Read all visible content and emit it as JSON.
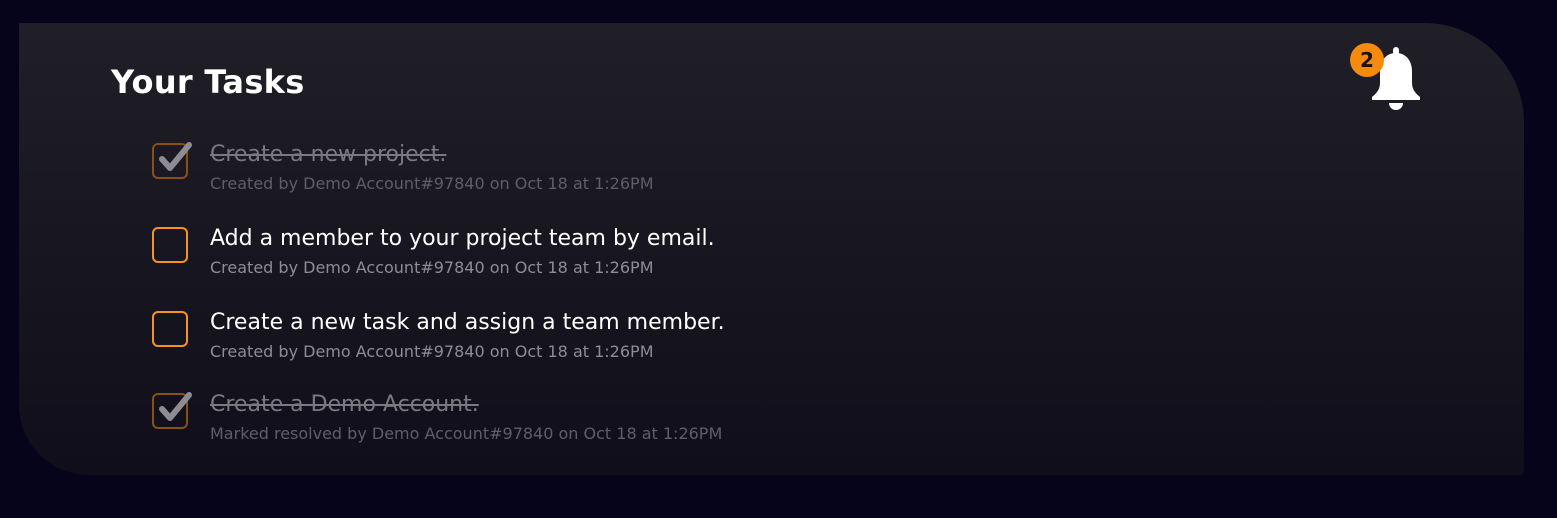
{
  "panel": {
    "title": "Your Tasks"
  },
  "notifications": {
    "icon": "bell-icon",
    "badge_count": "2",
    "badge_color": "#f58a0c"
  },
  "colors": {
    "background": "#05041a",
    "accent": "#f5931e",
    "text_primary": "#ffffff",
    "text_muted": "#8e8d96"
  },
  "tasks": [
    {
      "title": "Create a new project.",
      "meta": "Created by Demo Account#97840 on Oct 18 at 1:26PM",
      "completed": true
    },
    {
      "title": "Add a member to your project team by email.",
      "meta": "Created by Demo Account#97840 on Oct 18 at 1:26PM",
      "completed": false
    },
    {
      "title": "Create a new task and assign a team member.",
      "meta": "Created by Demo Account#97840 on Oct 18 at 1:26PM",
      "completed": false
    },
    {
      "title": "Create a Demo Account.",
      "meta": "Marked resolved by Demo Account#97840 on Oct 18 at 1:26PM",
      "completed": true
    }
  ]
}
